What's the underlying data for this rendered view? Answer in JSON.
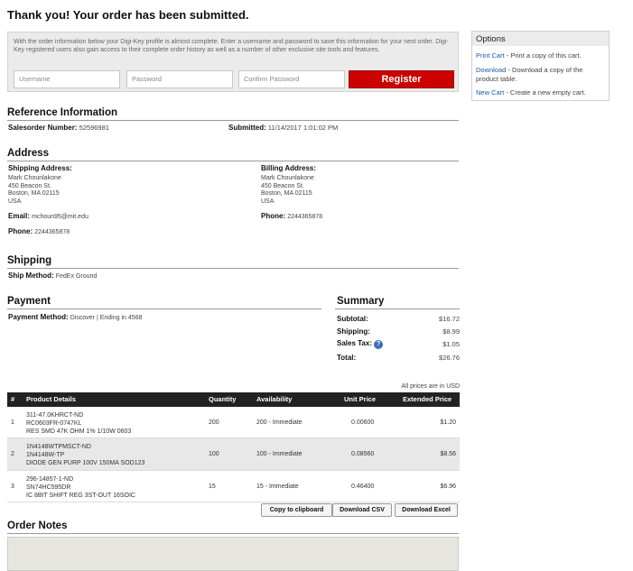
{
  "page_title": "Thank you! Your order has been submitted.",
  "registration": {
    "text": "With the order information below your Digi-Key profile is almost complete. Enter a username and password to save this information for your next order. Digi-Key registered users also gain access to their complete order history as well as a number of other exclusive site tools and features.",
    "username_placeholder": "Username",
    "password_placeholder": "Password",
    "confirm_placeholder": "Confirm Password",
    "register_label": "Register"
  },
  "options": {
    "title": "Options",
    "items": [
      {
        "link": "Print Cart",
        "desc": " - Print a copy of this cart."
      },
      {
        "link": "Download",
        "desc": " - Download a copy of the product table."
      },
      {
        "link": "New Cart",
        "desc": " - Create a new empty cart."
      }
    ]
  },
  "reference": {
    "title": "Reference Information",
    "salesorder_label": "Salesorder Number:",
    "salesorder_value": "52596981",
    "submitted_label": "Submitted:",
    "submitted_value": "11/14/2017 1:01:02 PM"
  },
  "address": {
    "title": "Address",
    "shipping_label": "Shipping Address:",
    "shipping_lines": [
      "Mark Chounlakone",
      "450 Beacon St.",
      "Boston, MA 02115",
      "USA"
    ],
    "billing_label": "Billing Address:",
    "billing_lines": [
      "Mark Chounlakone",
      "450 Beacon St.",
      "Boston, MA 02115",
      "USA"
    ],
    "email_label": "Email:",
    "email_value": "mchoun95@mit.edu",
    "phone_label": "Phone:",
    "phone_value": "2244365878",
    "billing_phone_label": "Phone:",
    "billing_phone_value": "2244365878"
  },
  "shipping": {
    "title": "Shipping",
    "method_label": "Ship Method:",
    "method_value": "FedEx Ground"
  },
  "payment": {
    "title": "Payment",
    "method_label": "Payment Method:",
    "method_value": "Discover | Ending in 4568"
  },
  "summary": {
    "title": "Summary",
    "subtotal_label": "Subtotal:",
    "subtotal_value": "$16.72",
    "shipping_label": "Shipping:",
    "shipping_value": "$8.99",
    "tax_label": "Sales Tax:",
    "tax_value": "$1.05",
    "total_label": "Total:",
    "total_value": "$26.76"
  },
  "table": {
    "currency_note": "All prices are in USD",
    "headers": [
      "#",
      "Product Details",
      "Quantity",
      "Availability",
      "Unit Price",
      "Extended Price"
    ],
    "rows": [
      {
        "num": "1",
        "lines": [
          "311-47.0KHRCT-ND",
          "RC0603FR-0747KL",
          "RES SMD 47K OHM 1% 1/10W 0603"
        ],
        "qty": "200",
        "avail": "200 - Immediate",
        "unit": "0.00600",
        "ext": "$1.20"
      },
      {
        "num": "2",
        "lines": [
          "1N4148WTPMSCT-ND",
          "1N4148W-TP",
          "DIODE GEN PURP 100V 150MA SOD123"
        ],
        "qty": "100",
        "avail": "100 - Immediate",
        "unit": "0.08560",
        "ext": "$8.56"
      },
      {
        "num": "3",
        "lines": [
          "296-14857-1-ND",
          "SN74HC595DR",
          "IC 8BIT SHIFT REG 3ST-OUT 16SOIC"
        ],
        "qty": "15",
        "avail": "15 - Immediate",
        "unit": "0.46400",
        "ext": "$6.96"
      }
    ],
    "copy_label": "Copy to clipboard",
    "csv_label": "Download CSV",
    "excel_label": "Download Excel"
  },
  "notes": {
    "title": "Order Notes"
  },
  "colors": {
    "register": "#cc0000",
    "link": "#1a5aa6",
    "table_header": "#222222"
  }
}
